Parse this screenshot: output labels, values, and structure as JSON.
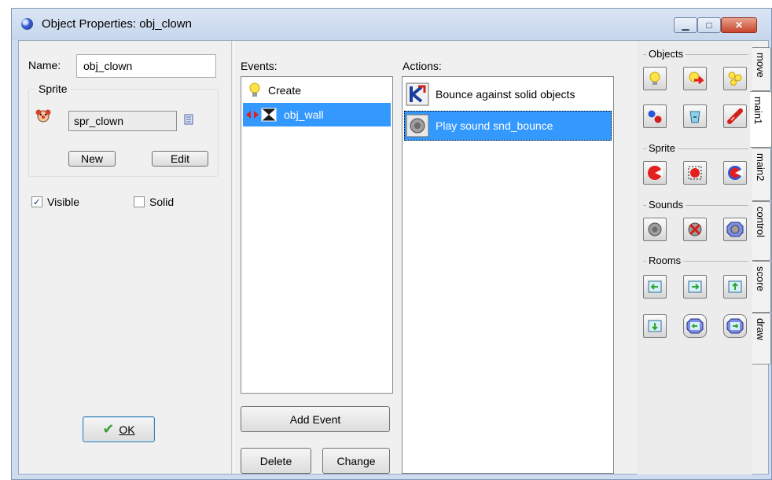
{
  "window": {
    "title": "Object Properties: obj_clown",
    "min_label": "▁",
    "max_label": "□",
    "close_label": "✕"
  },
  "left": {
    "name_label": "Name:",
    "name_value": "obj_clown",
    "sprite_group_label": "Sprite",
    "sprite_value": "spr_clown",
    "new_button": "New",
    "edit_button": "Edit",
    "visible_label": "Visible",
    "visible_checked": true,
    "solid_label": "Solid",
    "solid_checked": false,
    "ok_button": "OK"
  },
  "events": {
    "header": "Events:",
    "items": [
      {
        "label": "Create",
        "icon": "lightbulb-icon",
        "selected": false
      },
      {
        "label": "obj_wall",
        "icon": "collision-icon",
        "selected": true
      }
    ],
    "add_button": "Add Event",
    "delete_button": "Delete",
    "change_button": "Change"
  },
  "actions": {
    "header": "Actions:",
    "items": [
      {
        "label": "Bounce against solid objects",
        "icon": "bounce-icon",
        "selected": false
      },
      {
        "label": "Play sound snd_bounce",
        "icon": "sound-icon",
        "selected": true
      }
    ]
  },
  "palette": {
    "groups": [
      "Objects",
      "Sprite",
      "Sounds",
      "Rooms"
    ],
    "tabs": [
      "move",
      "main1",
      "main2",
      "control",
      "score",
      "draw"
    ],
    "active_tab": "main1"
  },
  "colors": {
    "selection": "#3399ff",
    "titlebar": "#cfdcef"
  }
}
